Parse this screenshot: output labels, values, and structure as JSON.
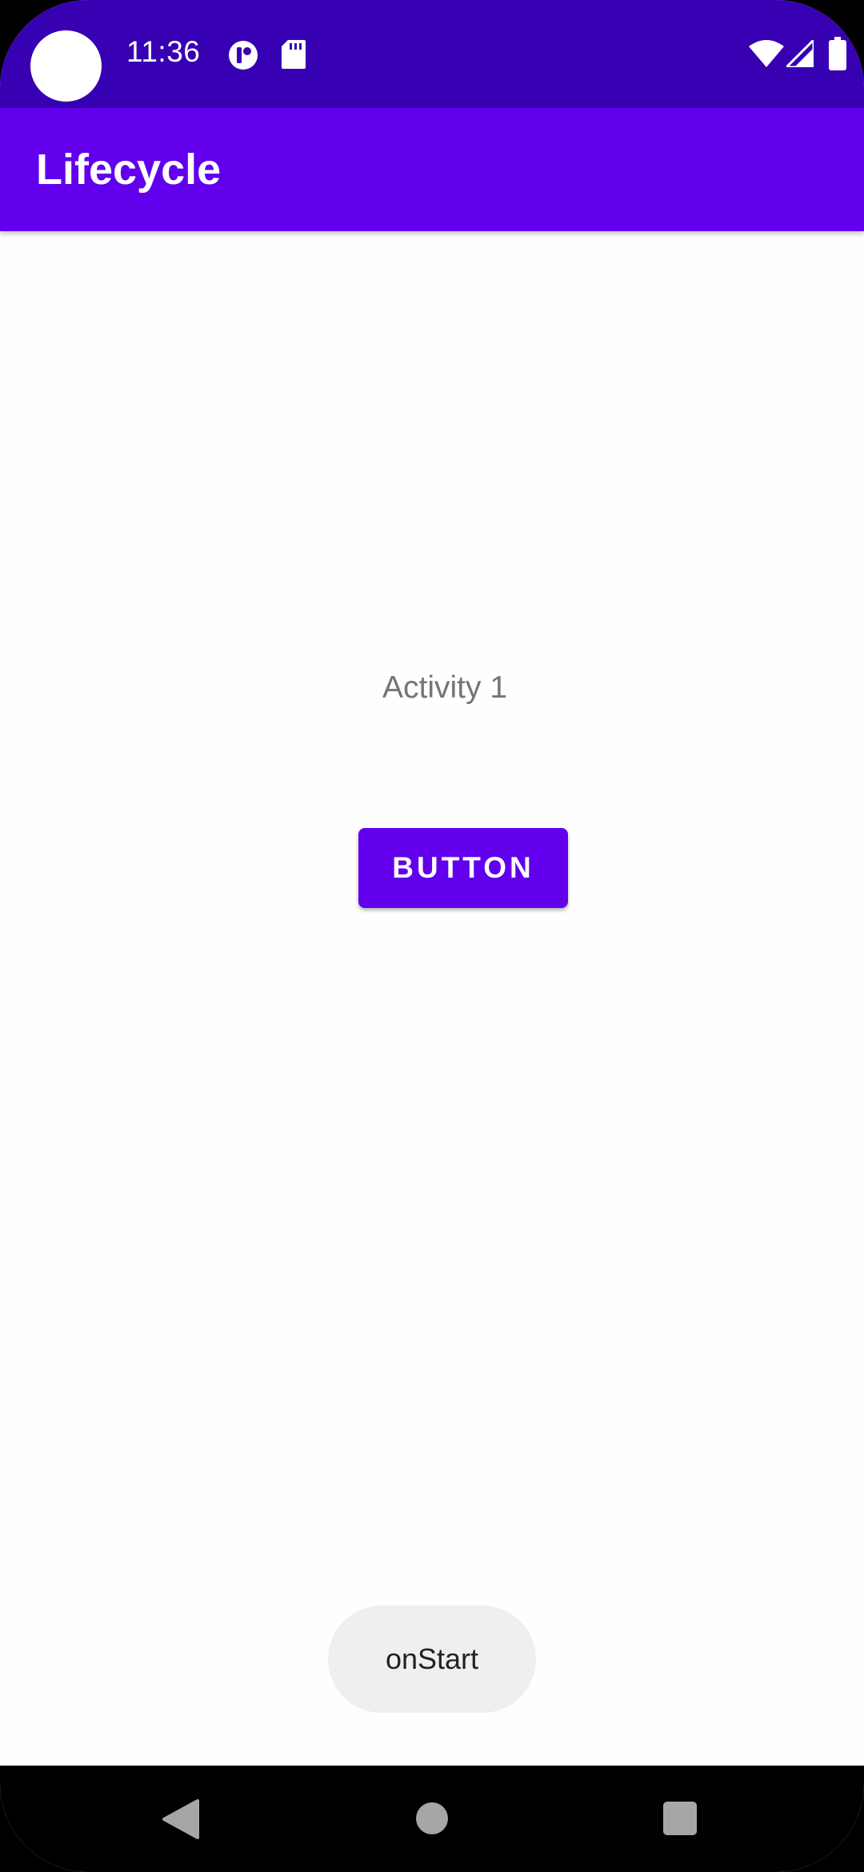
{
  "status_bar": {
    "time": "11:36",
    "icons": [
      "notification-icon",
      "sd-card-icon",
      "wifi-icon",
      "signal-icon",
      "battery-icon"
    ],
    "background": "#3700b3"
  },
  "app_bar": {
    "title": "Lifecycle",
    "background": "#6200ee"
  },
  "content": {
    "label": "Activity 1",
    "button_label": "BUTTON"
  },
  "toast": {
    "message": "onStart"
  },
  "nav_bar": {
    "buttons": [
      "back-icon",
      "home-icon",
      "recents-icon"
    ]
  }
}
